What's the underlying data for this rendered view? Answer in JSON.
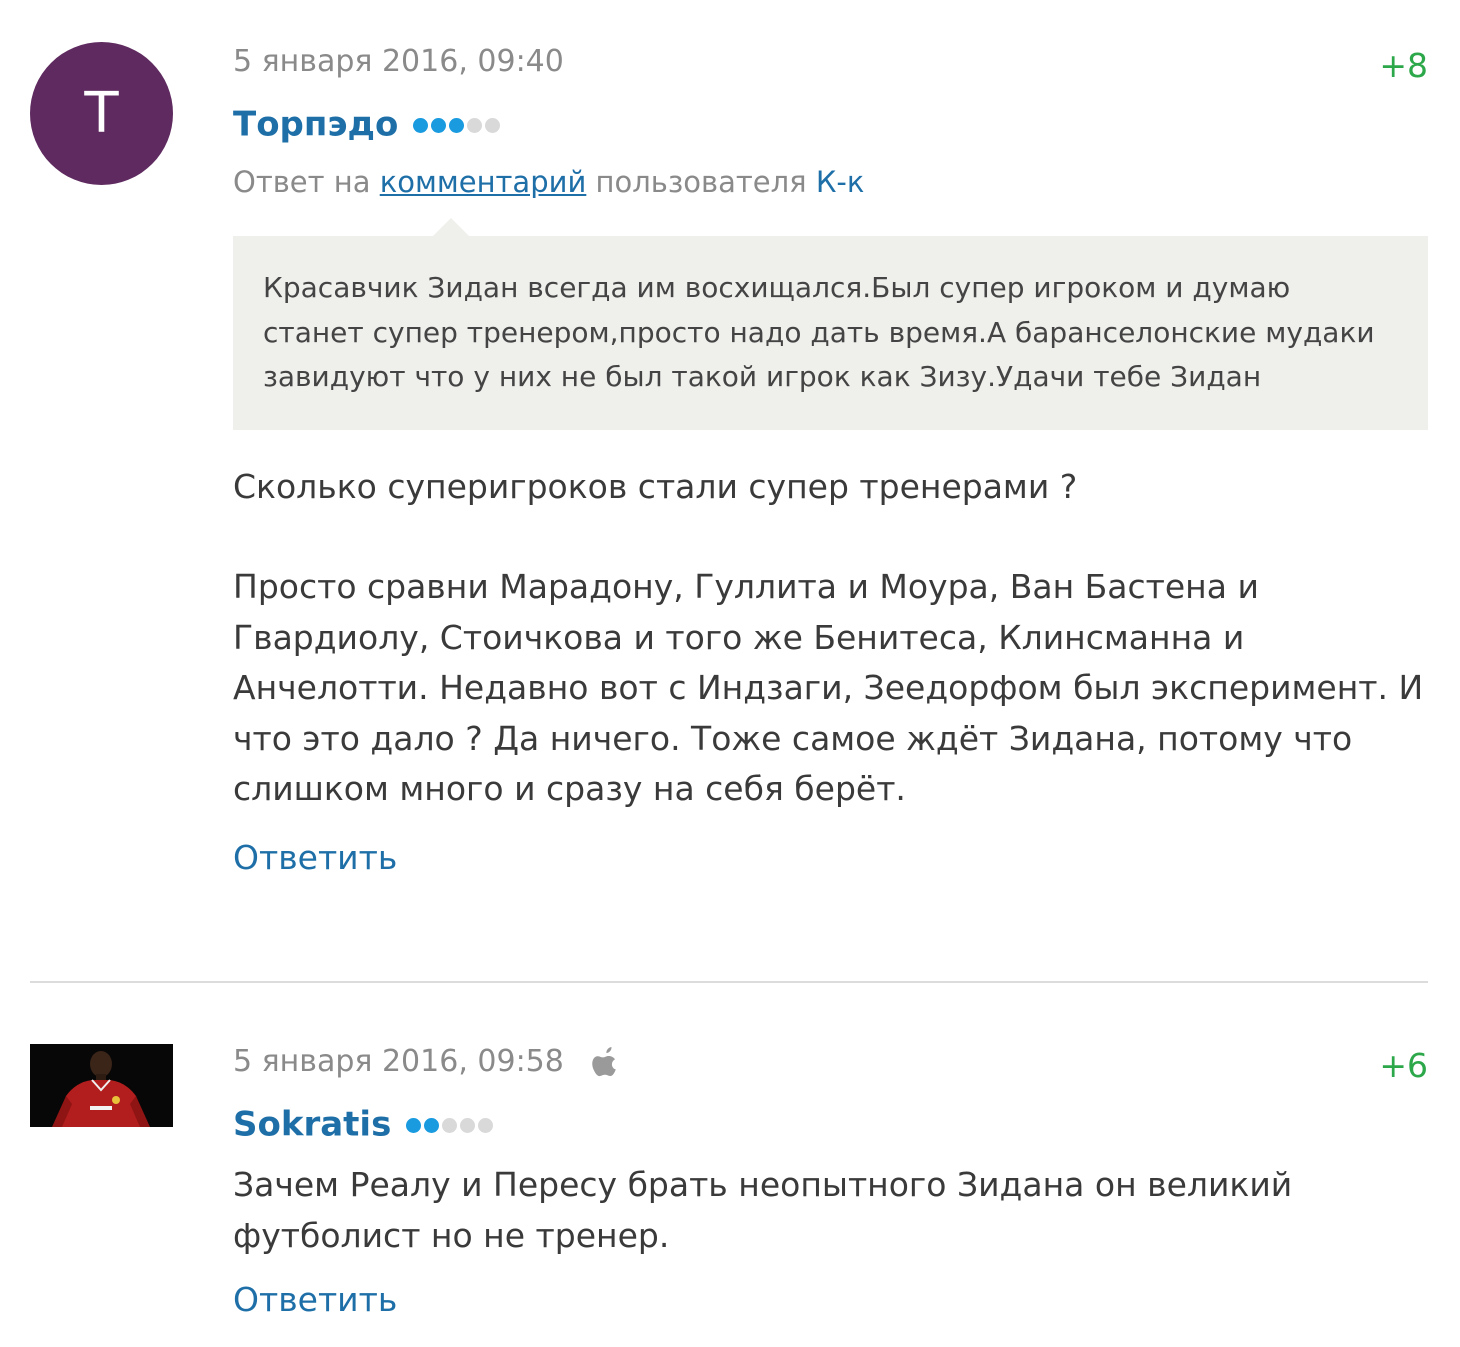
{
  "comments": [
    {
      "avatar_letter": "Т",
      "avatar_color": "#5e2a5f",
      "date": "5 января 2016, 09:40",
      "rating": "+8",
      "author": "Торпэдо",
      "level_dots_filled": 3,
      "level_dots_total": 5,
      "reply_prefix": "Ответ на",
      "reply_link": "комментарий",
      "reply_middle": "пользователя",
      "reply_user": "К-к",
      "quote": "Красавчик Зидан всегда им восхищался.Был супер игроком и думаю станет супер тренером,просто надо дать время.А баранселонские мудаки завидуют что у них не был такой игрок как Зизу.Удачи тебе Зидан",
      "paragraphs": [
        "Сколько суперигроков стали супер тренерами ?",
        "Просто сравни Марадону, Гуллита и Моура, Ван Бастена и Гвардиолу, Стоичкова и того же Бенитеса, Клинсманна и Анчелотти. Недавно вот с Индзаги, Зеедорфом был эксперимент. И что это дало ? Да ничего. Тоже самое ждёт Зидана, потому что слишком много и сразу на себя берёт."
      ],
      "reply_button": "Ответить"
    },
    {
      "avatar_icon": "user-photo",
      "date": "5 января 2016, 09:58",
      "platform_icon": "apple-icon",
      "rating": "+6",
      "author": "Sokratis",
      "level_dots_filled": 2,
      "level_dots_total": 5,
      "text": "Зачем Реалу и Пересу брать неопытного Зидана он великий футболист но не тренер.",
      "reply_button": "Ответить"
    }
  ],
  "colors": {
    "link": "#1e6fa8",
    "rating": "#2ca84a",
    "meta": "#8a8a8a",
    "dot_active": "#1a9be0",
    "dot_inactive": "#d9d9d9",
    "quote_bg": "#efefec"
  }
}
